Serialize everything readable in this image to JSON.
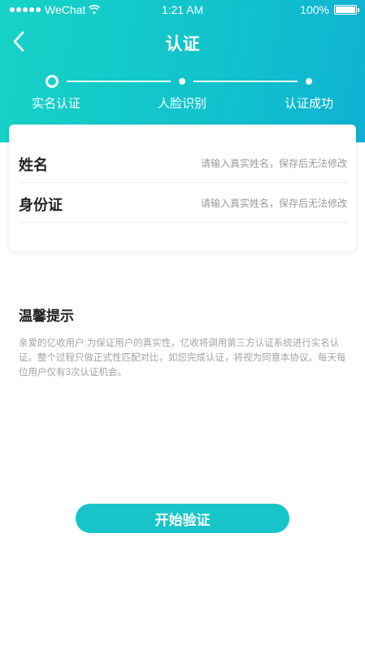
{
  "status_bar": {
    "carrier": "WeChat",
    "time": "1:21 AM",
    "battery_text": "100%",
    "signal_icon": "signal-dots-icon",
    "wifi_icon": "wifi-icon",
    "battery_icon": "battery-icon"
  },
  "nav": {
    "title": "认证",
    "back_icon": "chevron-left-icon"
  },
  "steps": [
    {
      "label": "实名认证",
      "active": true
    },
    {
      "label": "人脸识别",
      "active": false
    },
    {
      "label": "认证成功",
      "active": false
    }
  ],
  "form": {
    "name": {
      "label": "姓名",
      "value": "",
      "placeholder": "请输入真实姓名，保存后无法修改"
    },
    "id_number": {
      "label": "身份证",
      "value": "",
      "placeholder": "请输入真实姓名，保存后无法修改"
    }
  },
  "tips": {
    "title": "温馨提示",
    "body": "亲爱的亿收用户:为保证用户的真实性，亿收将调用第三方认证系统进行实名认证。整个过程只做正式性匹配对比，如您完成认证，将视为同意本协议。每天每位用户仅有3次认证机会。"
  },
  "start_button": {
    "label": "开始验证"
  },
  "colors": {
    "header_gradient_start": "#17d3c6",
    "header_gradient_end": "#0fb2d3",
    "accent": "#17c5c8",
    "hint_text": "#a3a3a3"
  }
}
